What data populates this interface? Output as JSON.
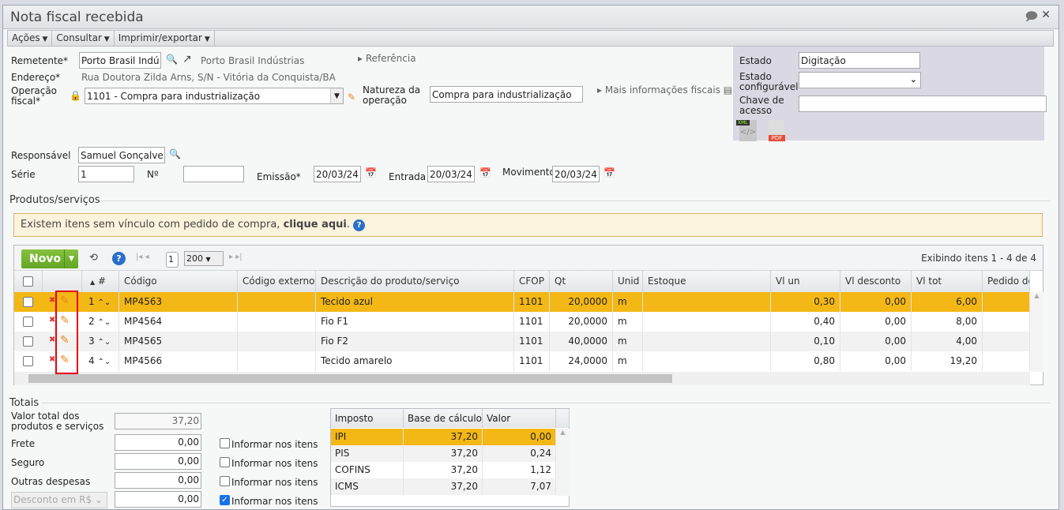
{
  "window": {
    "title": "Nota fiscal recebida"
  },
  "menu": [
    "Ações",
    "Consultar",
    "Imprimir/exportar"
  ],
  "form": {
    "remetente_label": "Remetente*",
    "remetente_value": "Porto Brasil Indúst",
    "remetente_link": "Porto Brasil Indústrias",
    "referencia": "Referência",
    "endereco_label": "Endereço*",
    "endereco_value": "Rua Doutora Zilda Arns, S/N - Vitória da Conquista/BA",
    "operacao_label1": "Operação",
    "operacao_label2": "fiscal*",
    "operacao_value": "1101 - Compra para industrialização",
    "natureza_label1": "Natureza da",
    "natureza_label2": "operação",
    "natureza_value": "Compra para industrialização",
    "mais_info": "Mais informações fiscais",
    "responsavel_label": "Responsável",
    "responsavel_value": "Samuel Gonçalves",
    "serie_label": "Série",
    "serie_value": "1",
    "numero_label": "Nº",
    "numero_value": "",
    "emissao_label": "Emissão*",
    "emissao_value": "20/03/24",
    "entrada_label": "Entrada",
    "entrada_value": "20/03/24",
    "movimento_label": "Movimento",
    "movimento_value": "20/03/24"
  },
  "status_panel": {
    "estado_label": "Estado",
    "estado_value": "Digitação",
    "estado_conf_label1": "Estado",
    "estado_conf_label2": "configurável",
    "chave_label1": "Chave de",
    "chave_label2": "acesso",
    "xml_label": "XML",
    "pdf_label": "PDF"
  },
  "products": {
    "section_title": "Produtos/serviços",
    "warning_text": "Existem itens sem vínculo com pedido de compra, ",
    "warning_link": "clique aqui",
    "new_button": "Novo",
    "page": "1",
    "page_size": "200",
    "showing": "Exibindo itens 1 - 4 de 4",
    "columns": [
      "#",
      "Código",
      "Código externo",
      "Descrição do produto/serviço",
      "CFOP",
      "Qt",
      "Unid",
      "Estoque",
      "Vl un",
      "Vl desconto",
      "Vl tot",
      "Pedido de"
    ],
    "rows": [
      {
        "n": "1",
        "codigo": "MP4563",
        "ext": "",
        "desc": "Tecido azul",
        "cfop": "1101",
        "qt": "20,0000",
        "unid": "m",
        "estoque": "",
        "vlun": "0,30",
        "vldesc": "0,00",
        "vltot": "6,00",
        "selected": true
      },
      {
        "n": "2",
        "codigo": "MP4564",
        "ext": "",
        "desc": "Fio F1",
        "cfop": "1101",
        "qt": "20,0000",
        "unid": "m",
        "estoque": "",
        "vlun": "0,40",
        "vldesc": "0,00",
        "vltot": "8,00"
      },
      {
        "n": "3",
        "codigo": "MP4565",
        "ext": "",
        "desc": "Fio F2",
        "cfop": "1101",
        "qt": "40,0000",
        "unid": "m",
        "estoque": "",
        "vlun": "0,10",
        "vldesc": "0,00",
        "vltot": "4,00"
      },
      {
        "n": "4",
        "codigo": "MP4566",
        "ext": "",
        "desc": "Tecido amarelo",
        "cfop": "1101",
        "qt": "24,0000",
        "unid": "m",
        "estoque": "",
        "vlun": "0,80",
        "vldesc": "0,00",
        "vltot": "19,20"
      }
    ]
  },
  "totals": {
    "section_title": "Totais",
    "valor_total_label1": "Valor total dos",
    "valor_total_label2": "produtos e serviços",
    "valor_total": "37,20",
    "frete_label": "Frete",
    "frete": "0,00",
    "seguro_label": "Seguro",
    "seguro": "0,00",
    "outras_label": "Outras despesas",
    "outras": "0,00",
    "desconto_select": "Desconto em R$",
    "desconto": "0,00",
    "informar_label": "Informar nos itens",
    "informar_checked": [
      false,
      false,
      false,
      true
    ]
  },
  "taxes": {
    "columns": [
      "Imposto",
      "Base de cálculo",
      "Valor"
    ],
    "rows": [
      {
        "imposto": "IPI",
        "base": "37,20",
        "valor": "0,00",
        "selected": true
      },
      {
        "imposto": "PIS",
        "base": "37,20",
        "valor": "0,24"
      },
      {
        "imposto": "COFINS",
        "base": "37,20",
        "valor": "1,12"
      },
      {
        "imposto": "ICMS",
        "base": "37,20",
        "valor": "7,07"
      }
    ]
  },
  "colors": {
    "selected_row": "#f3b716",
    "accent_green": "#6aad2a",
    "highlight_box": "#e8000b"
  }
}
